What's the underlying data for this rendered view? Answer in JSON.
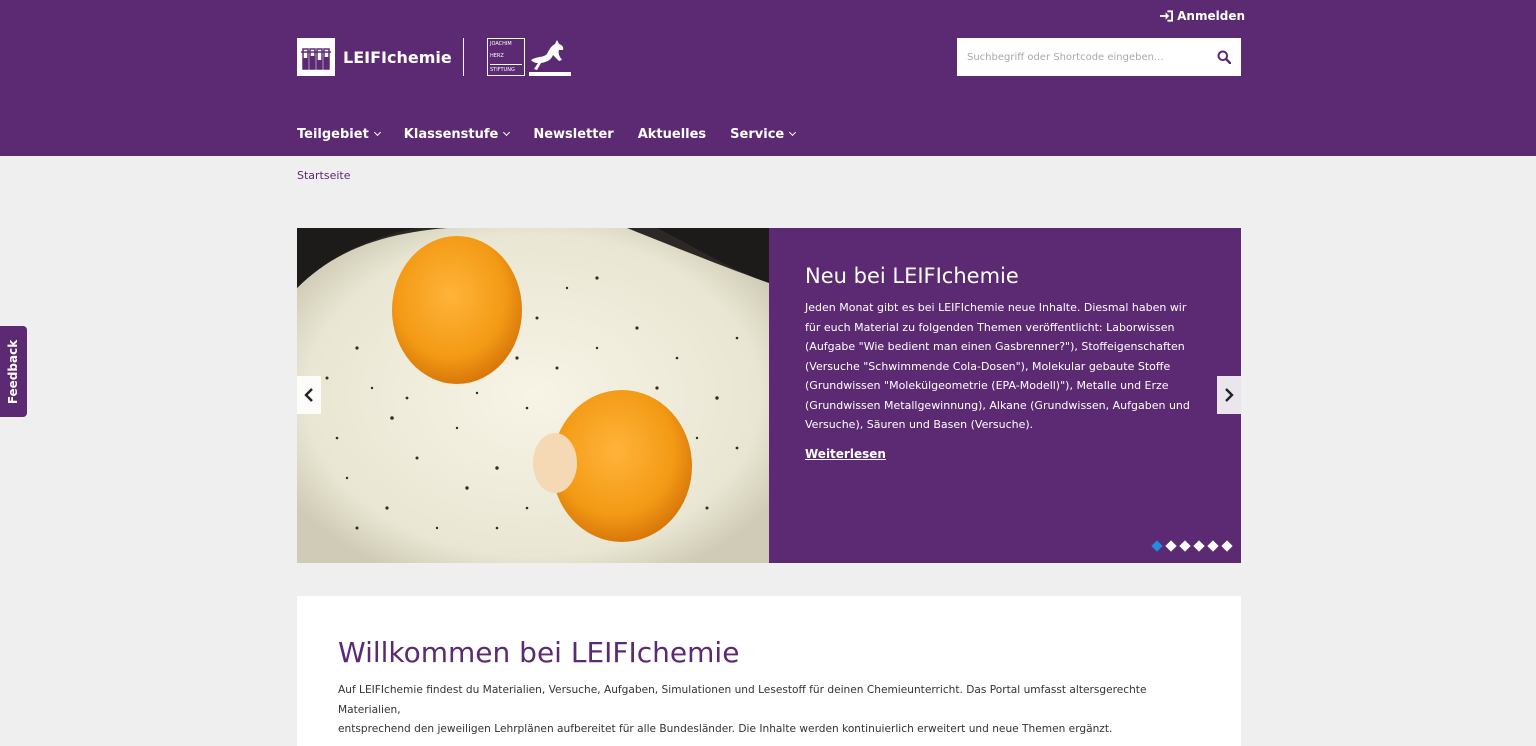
{
  "header": {
    "login_label": "Anmelden",
    "logo_text": "LEIFIchemie",
    "partner_lines": [
      "JOACHIM",
      "HERZ",
      "STIFTUNG"
    ]
  },
  "search": {
    "placeholder": "Suchbegriff oder Shortcode eingeben..."
  },
  "nav": {
    "items": [
      {
        "label": "Teilgebiet",
        "has_dropdown": true
      },
      {
        "label": "Klassenstufe",
        "has_dropdown": true
      },
      {
        "label": "Newsletter",
        "has_dropdown": false
      },
      {
        "label": "Aktuelles",
        "has_dropdown": false
      },
      {
        "label": "Service",
        "has_dropdown": true
      }
    ]
  },
  "breadcrumb": {
    "current": "Startseite"
  },
  "slider": {
    "title": "Neu bei LEIFIchemie",
    "text": "Jeden Monat gibt es bei LEIFIchemie neue Inhalte. Diesmal haben wir für euch Material zu folgenden Themen veröffentlicht: Laborwissen (Aufgabe \"Wie bedient man einen Gasbrenner?\"), Stoffeigenschaften (Versuche \"Schwimmende Cola-Dosen\"), Molekular gebaute Stoffe (Grundwissen \"Molekülgeometrie (EPA-Modell)\"), Metalle und Erze (Grundwissen Metallgewinnung), Alkane (Grundwissen, Aufgaben und Versuche), Säuren und Basen (Versuche).",
    "more_label": "Weiterlesen",
    "slide_count": 6,
    "active_slide": 1
  },
  "welcome": {
    "title": "Willkommen bei LEIFIchemie",
    "text_line1": "Auf LEIFIchemie findest du Materialien, Versuche, Aufgaben, Simulationen und Lesestoff für deinen Chemieunterricht.  Das Portal umfasst altersgerechte Materialien,",
    "text_line2": "entsprechend den jeweiligen Lehrplänen aufbereitet für alle Bundesländer. Die Inhalte werden kontinuierlich erweitert und neue Themen ergänzt."
  },
  "feedback": {
    "label": "Feedback"
  },
  "colors": {
    "brand_purple": "#5c2a72",
    "active_dot": "#1f8de0",
    "background": "#efefef"
  }
}
